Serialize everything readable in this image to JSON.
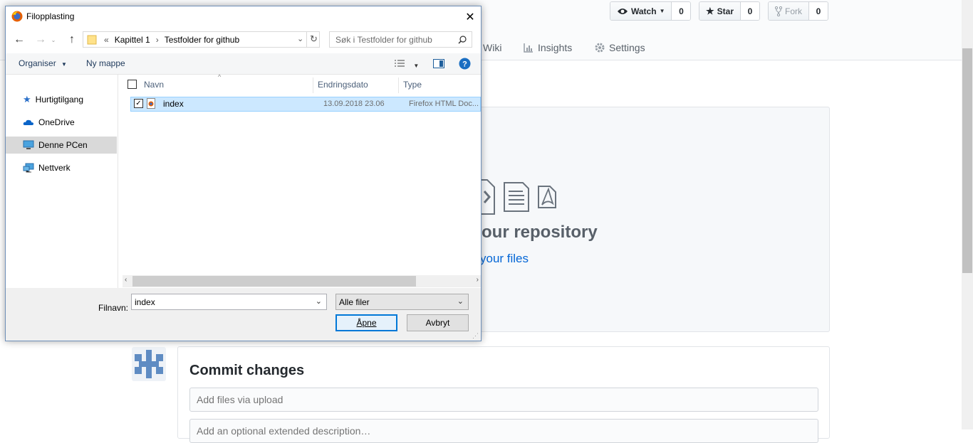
{
  "github": {
    "watch": {
      "label": "Watch",
      "count": "0"
    },
    "star": {
      "label": "Star",
      "count": "0"
    },
    "fork": {
      "label": "Fork",
      "count": "0"
    },
    "tabs": [
      {
        "label": "Wiki",
        "icon": "book-icon"
      },
      {
        "label": "Insights",
        "icon": "graph-icon"
      },
      {
        "label": "Settings",
        "icon": "gear-icon"
      }
    ],
    "drop_title": "hem to your repository",
    "drop_sub": "your files",
    "commit_title": "Commit changes",
    "commit_placeholder": "Add files via upload",
    "commit_desc_placeholder": "Add an optional extended description…"
  },
  "dialog": {
    "title": "Filopplasting",
    "breadcrumb": [
      "«",
      "Kapittel 1",
      "›",
      "Testfolder for github"
    ],
    "search_placeholder": "Søk i Testfolder for github",
    "toolbar": {
      "organize": "Organiser",
      "new_folder": "Ny mappe"
    },
    "nav_items": [
      {
        "label": "Hurtigtilgang",
        "icon": "star-icon",
        "selected": false
      },
      {
        "label": "OneDrive",
        "icon": "cloud-icon",
        "selected": false
      },
      {
        "label": "Denne PCen",
        "icon": "computer-icon",
        "selected": true
      },
      {
        "label": "Nettverk",
        "icon": "network-icon",
        "selected": false
      }
    ],
    "columns": [
      "Navn",
      "Endringsdato",
      "Type"
    ],
    "files": [
      {
        "name": "index",
        "date": "13.09.2018 23.06",
        "type": "Firefox HTML Doc...",
        "checked": true
      }
    ],
    "filename_label": "Filnavn:",
    "filename_value": "index",
    "filetype_value": "Alle filer",
    "open_button": "Åpne",
    "cancel_button": "Avbryt"
  },
  "colors": {
    "link": "#0366d6",
    "selection": "#cce8ff",
    "accent": "#0078d7"
  }
}
